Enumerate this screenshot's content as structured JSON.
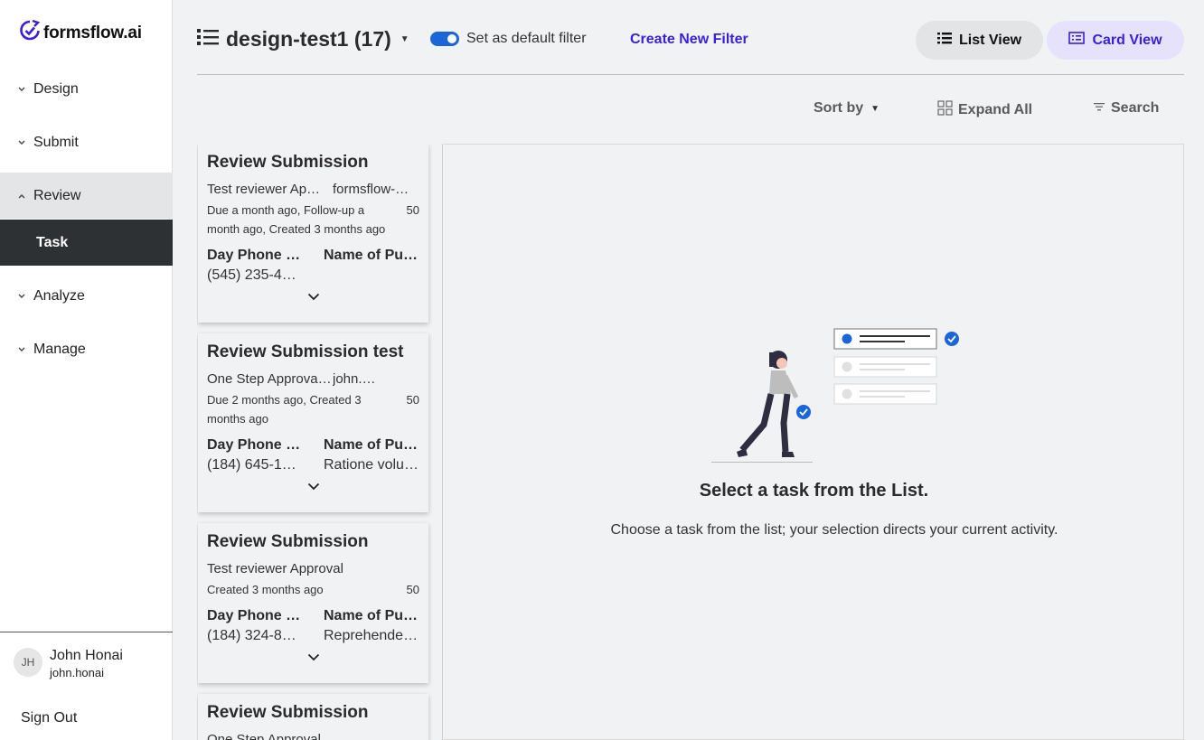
{
  "app": {
    "logo_text": "formsflow.ai"
  },
  "sidebar": {
    "items": [
      {
        "label": "Design"
      },
      {
        "label": "Submit"
      },
      {
        "label": "Review"
      },
      {
        "label": "Analyze"
      },
      {
        "label": "Manage"
      }
    ],
    "sub_item": {
      "label": "Task"
    },
    "user": {
      "initials": "JH",
      "name": "John Honai",
      "email": "john.honai"
    },
    "sign_out": "Sign Out"
  },
  "header": {
    "filter_name": "design-test1 (17)",
    "default_filter_label": "Set as default filter",
    "default_filter_on": true,
    "create_filter": "Create New Filter",
    "list_view": "List View",
    "card_view": "Card View"
  },
  "toolbar": {
    "sort_by": "Sort by",
    "expand_all": "Expand All",
    "search": "Search"
  },
  "tasks": [
    {
      "title": "Review Submission",
      "process": "Test reviewer Ap…",
      "assignee": "formsflow-…",
      "due": "Due a month ago, Follow-up a month ago, Created 3 months ago",
      "priority": "50",
      "col1_label": "Day Phone …",
      "col2_label": "Name of Pu…",
      "col1_value": "(545) 235-4…",
      "col2_value": ""
    },
    {
      "title": "Review Submission test",
      "process": "One Step Approval tas…",
      "assignee": "john.…",
      "due": "Due 2 months ago, Created 3 months ago",
      "priority": "50",
      "col1_label": "Day Phone …",
      "col2_label": "Name of Pu…",
      "col1_value": "(184) 645-1…",
      "col2_value": "Ratione volu…"
    },
    {
      "title": "Review Submission",
      "process": "Test reviewer Approval",
      "assignee": "",
      "due": "Created 3 months ago",
      "priority": "50",
      "col1_label": "Day Phone …",
      "col2_label": "Name of Pu…",
      "col1_value": "(184) 324-8…",
      "col2_value": "Reprehende…"
    },
    {
      "title": "Review Submission",
      "process": "One Step Approval…"
    }
  ],
  "empty_state": {
    "title": "Select a task from the List.",
    "subtitle": "Choose a task from the list; your selection directs your current activity."
  },
  "colors": {
    "accent": "#3a1fd6",
    "toggle": "#1a66d9",
    "sidebar_active": "#2e3133"
  }
}
